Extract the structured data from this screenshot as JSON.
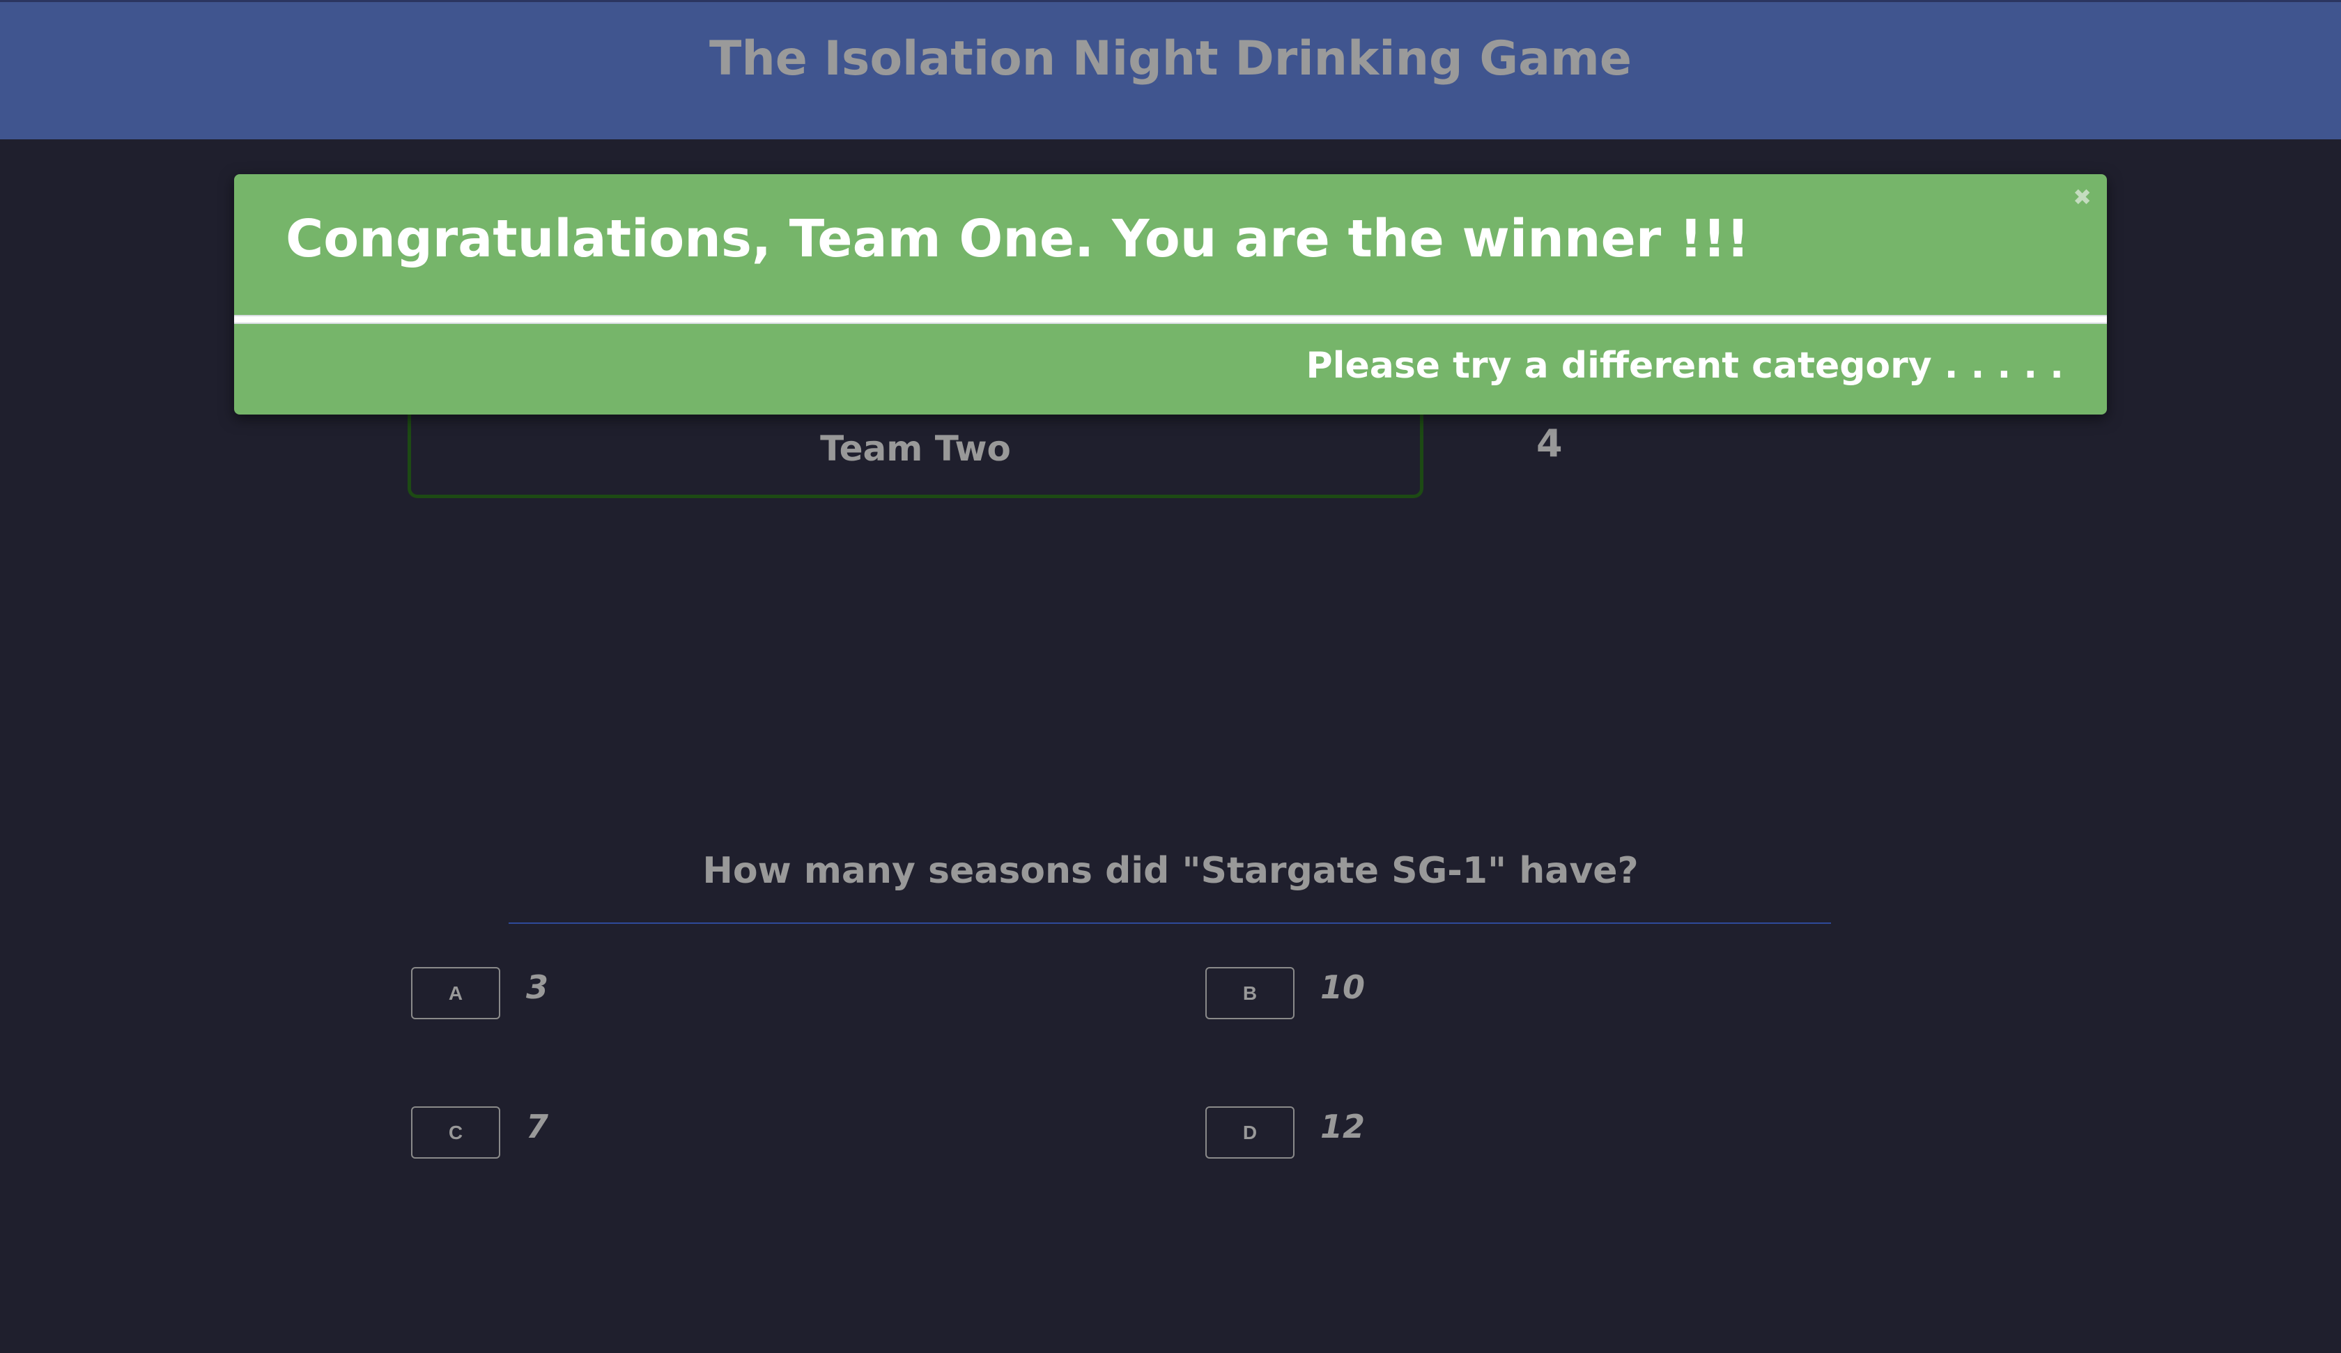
{
  "header": {
    "title": "The Isolation Night Drinking Game"
  },
  "teams": [
    {
      "name": "Team Two",
      "score": "4"
    }
  ],
  "modal": {
    "title": "Congratulations, Team One. You are the winner !!!",
    "subtitle": "Please try a different category . . . . .",
    "close_icon": "close-icon",
    "color": "#76b56a"
  },
  "question": {
    "text": "How many seasons did \"Stargate SG-1\" have?",
    "answers": [
      {
        "key": "A",
        "value": "3"
      },
      {
        "key": "B",
        "value": "10"
      },
      {
        "key": "C",
        "value": "7"
      },
      {
        "key": "D",
        "value": "12"
      }
    ]
  }
}
